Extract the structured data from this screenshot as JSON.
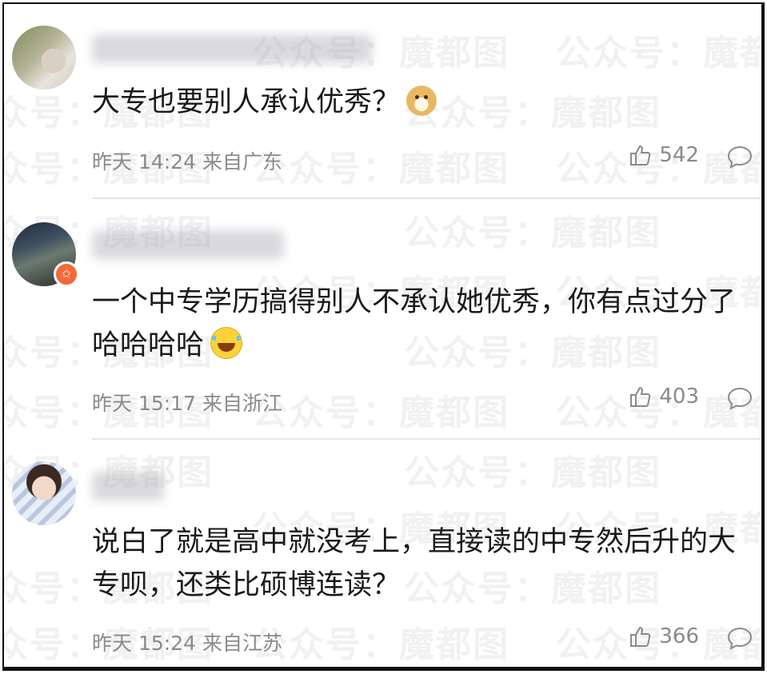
{
  "watermark": {
    "text": "公众号：魔都图"
  },
  "comments": [
    {
      "username": "█████████████",
      "content": "大专也要别人承认优秀？",
      "emoji": "doge-emoji",
      "time": "昨天 14:24",
      "location": "来自广东",
      "likes": "542"
    },
    {
      "username": "████████",
      "content": "一个中专学历搞得别人不承认她优秀，你有点过分了哈哈哈哈",
      "emoji": "laugh-tears-emoji",
      "time": "昨天 15:17",
      "location": "来自浙江",
      "likes": "403"
    },
    {
      "username": "███",
      "content": "说白了就是高中就没考上，直接读的中专然后升的大专呗，还类比硕博连读？",
      "emoji": "",
      "time": "昨天 15:24",
      "location": "来自江苏",
      "likes": "366"
    }
  ],
  "colors": {
    "text": "#1a1a1a",
    "meta": "#8a8a8a",
    "divider": "#e6e6e6",
    "badge": "#ef6b3a"
  },
  "icons": [
    "like-icon",
    "reply-icon",
    "verified-badge-icon"
  ]
}
